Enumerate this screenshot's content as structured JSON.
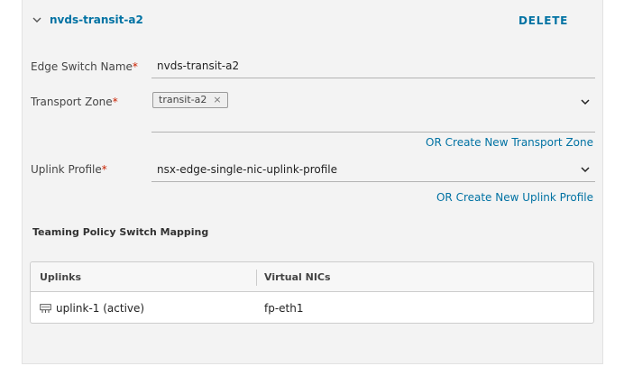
{
  "section": {
    "title": "nvds-transit-a2",
    "delete_label": "DELETE"
  },
  "form": {
    "edge_switch_name": {
      "label": "Edge Switch Name",
      "required_mark": "*",
      "value": "nvds-transit-a2"
    },
    "transport_zone": {
      "label": "Transport Zone",
      "required_mark": "*",
      "chips": [
        "transit-a2"
      ],
      "chip_remove": "×",
      "create_link": "OR Create New Transport Zone"
    },
    "uplink_profile": {
      "label": "Uplink Profile",
      "required_mark": "*",
      "value": "nsx-edge-single-nic-uplink-profile",
      "create_link": "OR Create New Uplink Profile"
    }
  },
  "teaming": {
    "title": "Teaming Policy Switch Mapping",
    "columns": [
      "Uplinks",
      "Virtual NICs"
    ],
    "rows": [
      {
        "uplink": "uplink-1 (active)",
        "vnic": "fp-eth1",
        "icon": "network-adapter-icon"
      }
    ]
  },
  "colors": {
    "link": "#0072a3",
    "required": "#c92100",
    "panel": "#f3f3f3"
  }
}
